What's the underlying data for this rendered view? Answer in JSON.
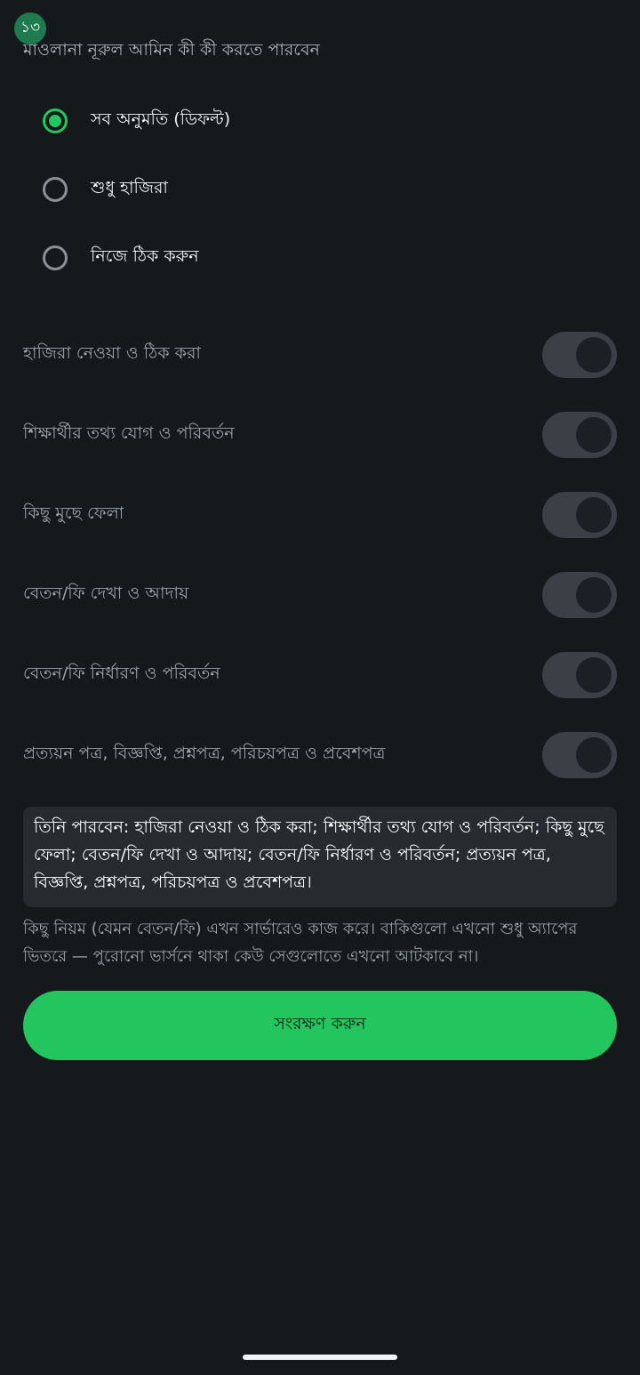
{
  "step_badge": "১৩",
  "heading": "মাওলানা নূরুল আমিন কী কী করতে পারবেন",
  "presets": [
    {
      "label": "সব অনুমতি (ডিফল্ট)",
      "selected": true
    },
    {
      "label": "শুধু হাজিরা",
      "selected": false
    },
    {
      "label": "নিজে ঠিক করুন",
      "selected": false
    }
  ],
  "permissions": [
    {
      "label": "হাজিরা নেওয়া ও ঠিক করা",
      "enabled": false
    },
    {
      "label": "শিক্ষার্থীর তথ্য যোগ ও পরিবর্তন",
      "enabled": false
    },
    {
      "label": "কিছু মুছে ফেলা",
      "enabled": false
    },
    {
      "label": "বেতন/ফি দেখা ও আদায়",
      "enabled": false
    },
    {
      "label": "বেতন/ফি নির্ধারণ ও পরিবর্তন",
      "enabled": false
    },
    {
      "label": "প্রত্যয়ন পত্র, বিজ্ঞপ্তি, প্রশ্নপত্র, পরিচয়পত্র ও প্রবেশপত্র",
      "enabled": false
    }
  ],
  "summary": "তিনি পারবেন: হাজিরা নেওয়া ও ঠিক করা; শিক্ষার্থীর তথ্য যোগ ও পরিবর্তন; কিছু মুছে ফেলা; বেতন/ফি দেখা ও আদায়; বেতন/ফি নির্ধারণ ও পরিবর্তন; প্রত্যয়ন পত্র, বিজ্ঞপ্তি, প্রশ্নপত্র, পরিচয়পত্র ও প্রবেশপত্র।",
  "note": "কিছু নিয়ম (যেমন বেতন/ফি) এখন সার্ভারেও কাজ করে। বাকিগুলো এখনো শুধু অ্যাপের ভিতরে — পুরোনো ভার্সনে থাকা কেউ সেগুলোতে এখনো আটকাবে না।",
  "save_button": "সংরক্ষণ করুন",
  "colors": {
    "background": "#16191c",
    "accent": "#22c55e",
    "badge": "#1f7a4f",
    "toggle_off": "#3c4046",
    "summary_bg": "#272b30"
  }
}
